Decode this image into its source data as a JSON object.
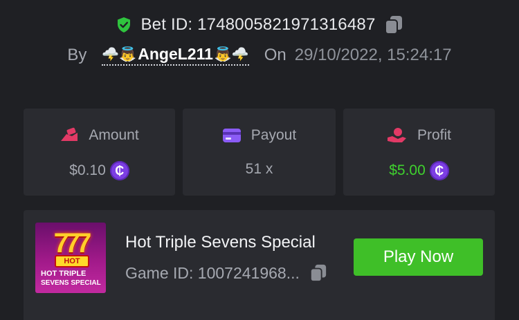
{
  "header": {
    "bet_label": "Bet ID: 1748005821971316487",
    "by_label": "By",
    "username": "AngeL211",
    "emoji_left": "🌩️👼",
    "emoji_right": "👼🌩️",
    "on_label": "On",
    "timestamp": "29/10/2022, 15:24:17"
  },
  "stats": {
    "amount": {
      "label": "Amount",
      "value": "$0.10",
      "icon": "money-hand-icon"
    },
    "payout": {
      "label": "Payout",
      "value": "51 x",
      "icon": "card-icon"
    },
    "profit": {
      "label": "Profit",
      "value": "$5.00",
      "icon": "profit-hand-icon"
    },
    "coin_symbol": "₵"
  },
  "game": {
    "name": "Hot Triple Sevens Special",
    "game_id": "Game ID: 1007241968...",
    "play_label": "Play Now",
    "thumb_hot": "HOT",
    "thumb_line1": "HOT TRIPLE",
    "thumb_line2": "SEVENS SPECIAL",
    "thumb_sevens": "777"
  },
  "colors": {
    "accent_green": "#3fbf28",
    "profit_green": "#3fd12e",
    "coin_purple": "#7c3ee3",
    "shield_green": "#2fc43e",
    "icon_pink": "#e23a66"
  }
}
